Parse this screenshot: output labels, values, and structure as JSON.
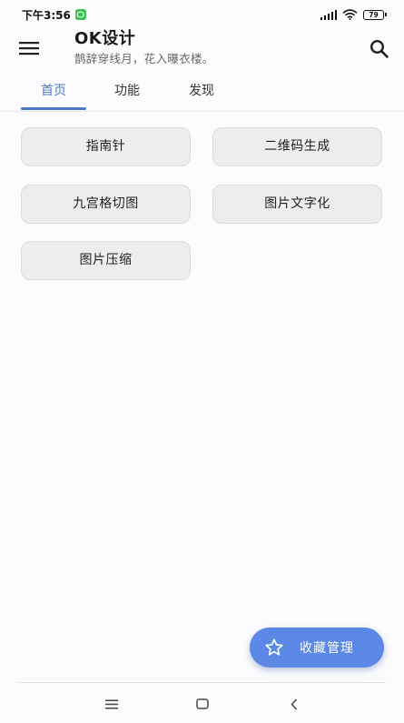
{
  "status_bar": {
    "time": "下午3:56",
    "battery": "79"
  },
  "app_bar": {
    "title": "OK设计",
    "subtitle": "鹊辞穿线月，花入曝衣楼。"
  },
  "tabs": [
    {
      "label": "首页",
      "active": true
    },
    {
      "label": "功能",
      "active": false
    },
    {
      "label": "发现",
      "active": false
    }
  ],
  "tools": [
    {
      "label": "指南针"
    },
    {
      "label": "二维码生成"
    },
    {
      "label": "九宫格切图"
    },
    {
      "label": "图片文字化"
    },
    {
      "label": "图片压缩"
    }
  ],
  "fab": {
    "label": "收藏管理",
    "icon": "star-outline-icon"
  },
  "colors": {
    "accent": "#4a7bd0",
    "fab": "#5c89e6",
    "button_bg": "#ededed"
  }
}
